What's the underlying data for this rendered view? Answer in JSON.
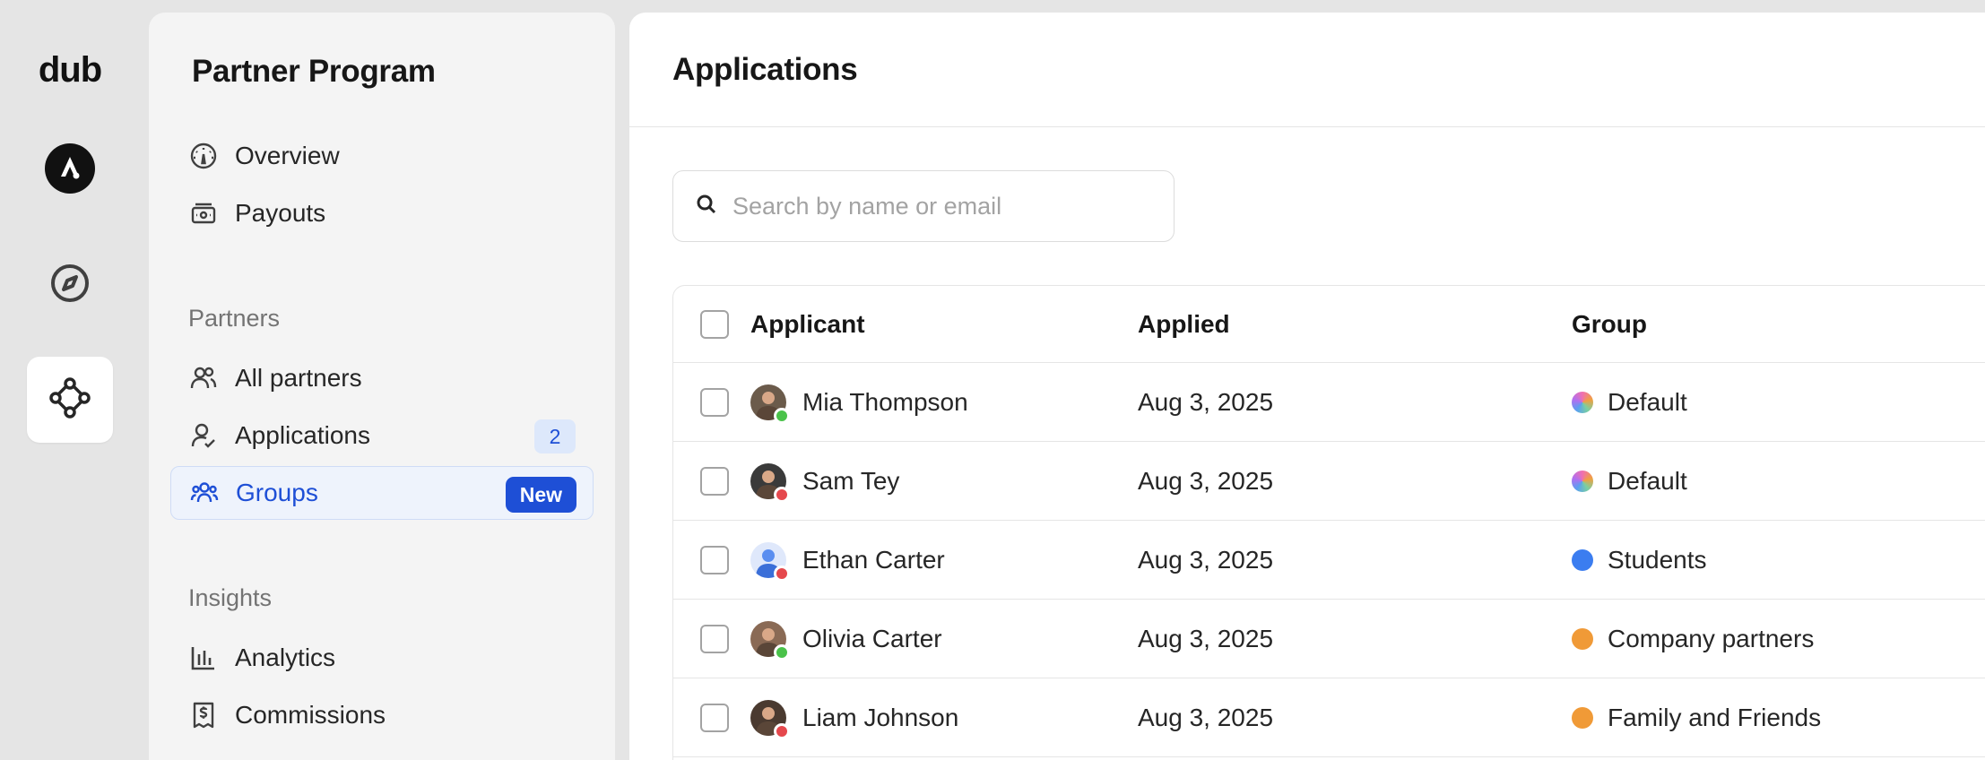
{
  "rail": {
    "logo": "dub",
    "items": [
      {
        "name": "workspace-avatar",
        "active": false
      },
      {
        "name": "explore",
        "active": false
      },
      {
        "name": "partner-program",
        "active": true
      }
    ]
  },
  "sidebar": {
    "title": "Partner Program",
    "top_items": [
      {
        "label": "Overview",
        "icon": "gauge-icon"
      },
      {
        "label": "Payouts",
        "icon": "money-icon"
      }
    ],
    "partners_section": "Partners",
    "partner_items": [
      {
        "label": "All partners",
        "icon": "users-icon"
      },
      {
        "label": "Applications",
        "icon": "user-check-icon",
        "badge": "2"
      },
      {
        "label": "Groups",
        "icon": "users-group-icon",
        "badge": "New",
        "active": true
      }
    ],
    "insights_section": "Insights",
    "insight_items": [
      {
        "label": "Analytics",
        "icon": "chart-icon"
      },
      {
        "label": "Commissions",
        "icon": "receipt-icon"
      }
    ]
  },
  "main": {
    "title": "Applications",
    "search": {
      "placeholder": "Search by name or email",
      "value": ""
    },
    "table": {
      "columns": [
        "Applicant",
        "Applied",
        "Group"
      ],
      "rows": [
        {
          "name": "Mia Thompson",
          "applied": "Aug 3, 2025",
          "group": "Default",
          "group_color": "gradient",
          "status": "#4ac24a",
          "avatar_bg": "#6b5b4b"
        },
        {
          "name": "Sam Tey",
          "applied": "Aug 3, 2025",
          "group": "Default",
          "group_color": "gradient",
          "status": "#e5484d",
          "avatar_bg": "#3a3a3a"
        },
        {
          "name": "Ethan Carter",
          "applied": "Aug 3, 2025",
          "group": "Students",
          "group_color": "#3b7df0",
          "status": "#e5484d",
          "avatar_bg": "#dfe8fb"
        },
        {
          "name": "Olivia Carter",
          "applied": "Aug 3, 2025",
          "group": "Company partners",
          "group_color": "#f09a37",
          "status": "#4ac24a",
          "avatar_bg": "#8a6a55"
        },
        {
          "name": "Liam Johnson",
          "applied": "Aug 3, 2025",
          "group": "Family and Friends",
          "group_color": "#f09a37",
          "status": "#e5484d",
          "avatar_bg": "#4a3a30"
        }
      ]
    }
  }
}
